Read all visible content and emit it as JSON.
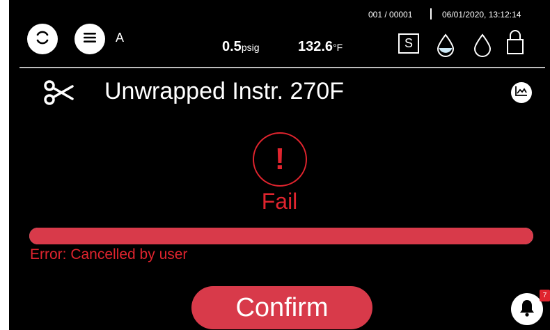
{
  "header": {
    "operator_label": "A",
    "cycle_counter": "001 / 00001",
    "datetime": "06/01/2020, 13:12:14",
    "pressure_value": "0.5",
    "pressure_unit": "psig",
    "temperature_value": "132.6",
    "temperature_unit": "°F",
    "mode_indicator": "S",
    "icons": [
      "refresh-icon",
      "menu-icon",
      "water-level-icon",
      "water-drop-icon",
      "lock-icon"
    ]
  },
  "cycle": {
    "icon": "scissors-icon",
    "title": "Unwrapped Instr. 270F",
    "chart_icon": "chart-icon"
  },
  "result": {
    "alert_symbol": "!",
    "status": "Fail",
    "progress_percent": 100,
    "error_message": "Error: Cancelled by user"
  },
  "actions": {
    "confirm_label": "Confirm"
  },
  "notifications": {
    "badge_count": "7",
    "icon": "bell-icon"
  },
  "colors": {
    "background": "#000000",
    "fail_red": "#e0242e",
    "button_red": "#d83a4a",
    "foreground": "#ffffff"
  }
}
